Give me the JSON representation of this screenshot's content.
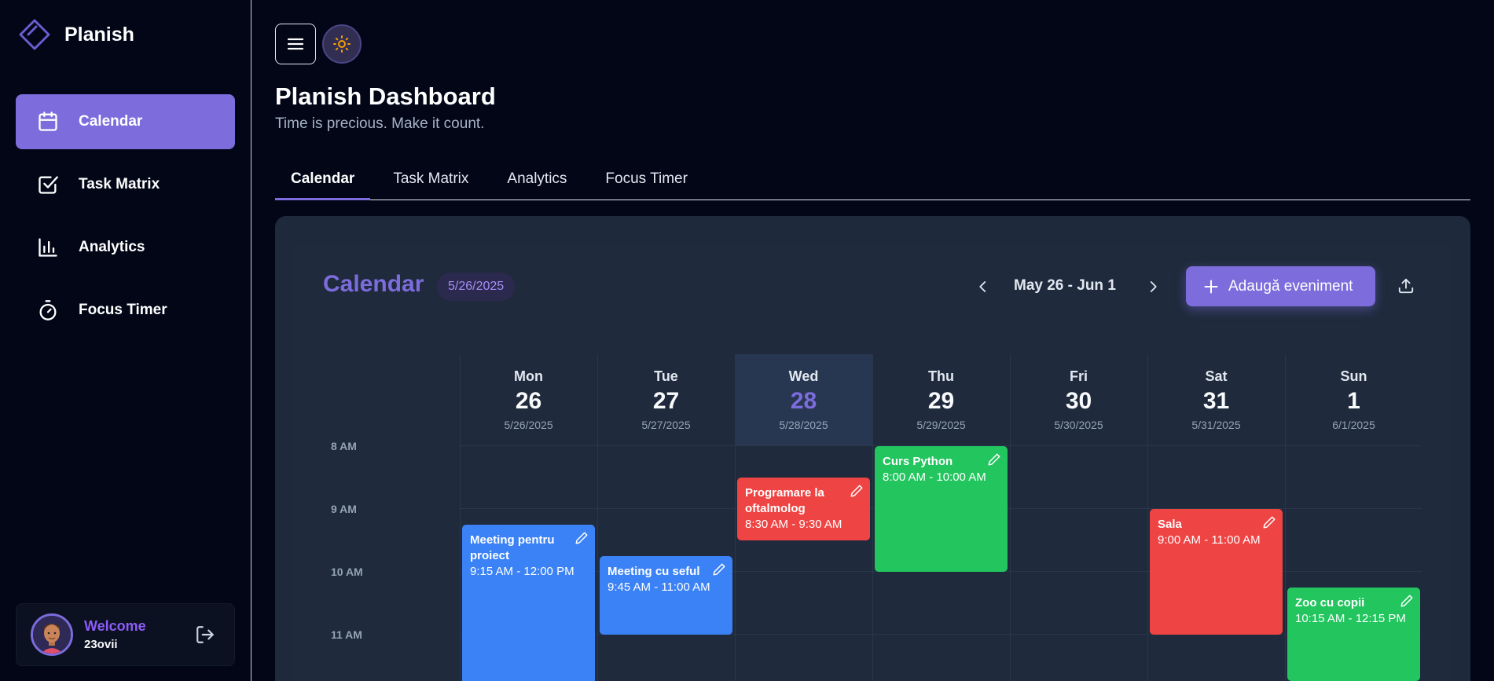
{
  "brand": {
    "name": "Planish"
  },
  "sidebar": {
    "items": [
      {
        "label": "Calendar",
        "icon": "calendar-icon"
      },
      {
        "label": "Task Matrix",
        "icon": "checkbox-icon"
      },
      {
        "label": "Analytics",
        "icon": "bar-chart-icon"
      },
      {
        "label": "Focus Timer",
        "icon": "stopwatch-icon"
      }
    ]
  },
  "user": {
    "welcome": "Welcome",
    "name": "23ovii"
  },
  "header": {
    "title": "Planish Dashboard",
    "subtitle": "Time is precious. Make it count."
  },
  "tabs": [
    {
      "label": "Calendar"
    },
    {
      "label": "Task Matrix"
    },
    {
      "label": "Analytics"
    },
    {
      "label": "Focus Timer"
    }
  ],
  "calendar": {
    "title": "Calendar",
    "current_date": "5/26/2025",
    "range": "May 26 - Jun 1",
    "add_label": "Adaugă eveniment",
    "days": [
      {
        "name": "Mon",
        "num": "26",
        "date": "5/26/2025"
      },
      {
        "name": "Tue",
        "num": "27",
        "date": "5/27/2025"
      },
      {
        "name": "Wed",
        "num": "28",
        "date": "5/28/2025"
      },
      {
        "name": "Thu",
        "num": "29",
        "date": "5/29/2025"
      },
      {
        "name": "Fri",
        "num": "30",
        "date": "5/30/2025"
      },
      {
        "name": "Sat",
        "num": "31",
        "date": "5/31/2025"
      },
      {
        "name": "Sun",
        "num": "1",
        "date": "6/1/2025"
      }
    ],
    "times": [
      "8 AM",
      "9 AM",
      "10 AM",
      "11 AM"
    ],
    "events": [
      {
        "title": "Meeting pentru proiect",
        "time": "9:15 AM - 12:00 PM",
        "color": "blue"
      },
      {
        "title": "Meeting cu seful",
        "time": "9:45 AM - 11:00 AM",
        "color": "blue"
      },
      {
        "title": "Programare la oftalmolog",
        "time": "8:30 AM - 9:30 AM",
        "color": "red"
      },
      {
        "title": "Curs Python",
        "time": "8:00 AM - 10:00 AM",
        "color": "green"
      },
      {
        "title": "Sala",
        "time": "9:00 AM - 11:00 AM",
        "color": "red"
      },
      {
        "title": "Zoo cu copii",
        "time": "10:15 AM - 12:15 PM",
        "color": "green"
      }
    ]
  },
  "colors": {
    "accent": "#7c6cdc",
    "background": "#020617",
    "panel": "#1e293b",
    "blue": "#3b82f6",
    "red": "#ef4444",
    "green": "#22c55e"
  }
}
